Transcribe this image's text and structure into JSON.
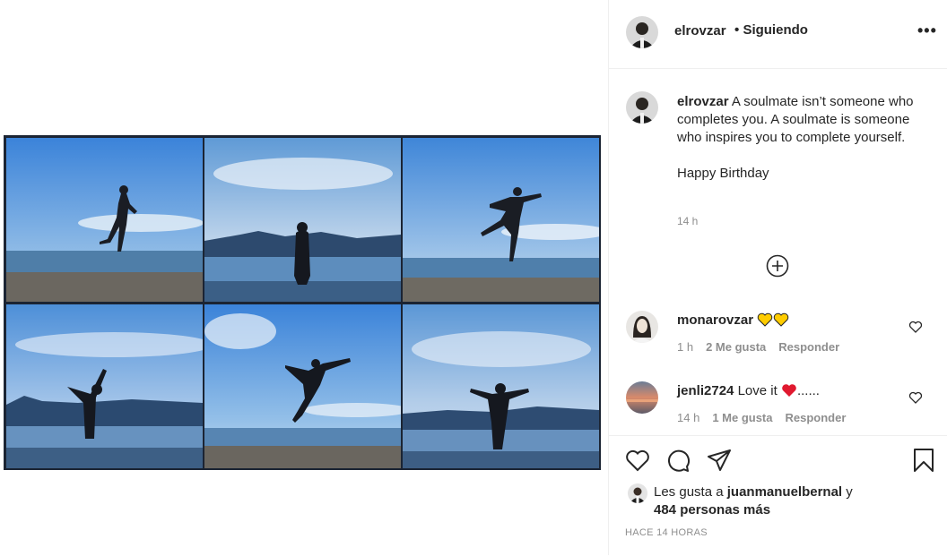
{
  "post": {
    "author": "elrovzar",
    "follow_separator": "•",
    "follow_status": "Siguiendo",
    "more_label": "•••",
    "caption": {
      "username": "elrovzar",
      "line1": "A soulmate isn’t someone who completes you. A soulmate is someone who inspires you to complete yourself.",
      "line2": "Happy Birthday",
      "time": "14 h"
    },
    "comments": [
      {
        "username": "monarovzar",
        "text": "",
        "emoji": [
          "yellow-heart",
          "yellow-heart"
        ],
        "time": "1 h",
        "likes": "2 Me gusta",
        "reply": "Responder"
      },
      {
        "username": "jenli2724",
        "text": "Love it",
        "emoji": [
          "red-heart"
        ],
        "suffix": "......",
        "time": "14 h",
        "likes": "1 Me gusta",
        "reply": "Responder"
      }
    ],
    "likes": {
      "prefix": "Les gusta a",
      "user": "juanmanuelbernal",
      "joiner": "y",
      "others": "484 personas más"
    },
    "posted_ago": "HACE 14 HORAS"
  },
  "colors": {
    "sky": "#4a8fd6",
    "sea": "#2f6fb0",
    "border": "#1b2433",
    "heart_yellow": "#ffcc00",
    "heart_red": "#e0192f"
  },
  "icons": {
    "like": "heart-outline-icon",
    "comment": "speech-bubble-icon",
    "share": "paper-plane-icon",
    "save": "bookmark-icon",
    "load_more": "plus-circle-icon"
  }
}
